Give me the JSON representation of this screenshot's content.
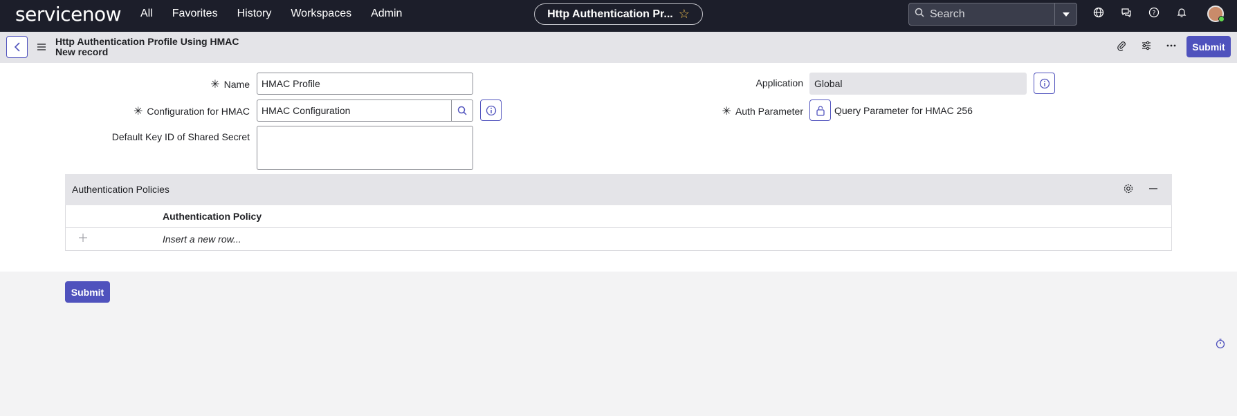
{
  "topnav": {
    "logo": "servicenow",
    "links": [
      "All",
      "Favorites",
      "History",
      "Workspaces",
      "Admin"
    ],
    "page_title": "Http Authentication Pr...",
    "search_placeholder": "Search"
  },
  "header": {
    "record_title": "Http Authentication Profile Using HMAC",
    "record_subtitle": "New record",
    "submit_label": "Submit"
  },
  "form": {
    "name_label": "Name",
    "name_value": "HMAC Profile",
    "config_label": "Configuration for HMAC",
    "config_value": "HMAC Configuration",
    "default_key_label": "Default Key ID of Shared Secret",
    "default_key_value": "",
    "application_label": "Application",
    "application_value": "Global",
    "auth_param_label": "Auth Parameter",
    "auth_param_value": "Query Parameter for HMAC 256",
    "required_marker": "✳"
  },
  "related_list": {
    "title": "Authentication Policies",
    "column": "Authentication Policy",
    "insert_text": "Insert a new row..."
  },
  "footer": {
    "submit_label": "Submit"
  },
  "colors": {
    "nav_bg": "#1c1e2a",
    "accent": "#4f52bd",
    "header_bg": "#e4e4e8"
  }
}
